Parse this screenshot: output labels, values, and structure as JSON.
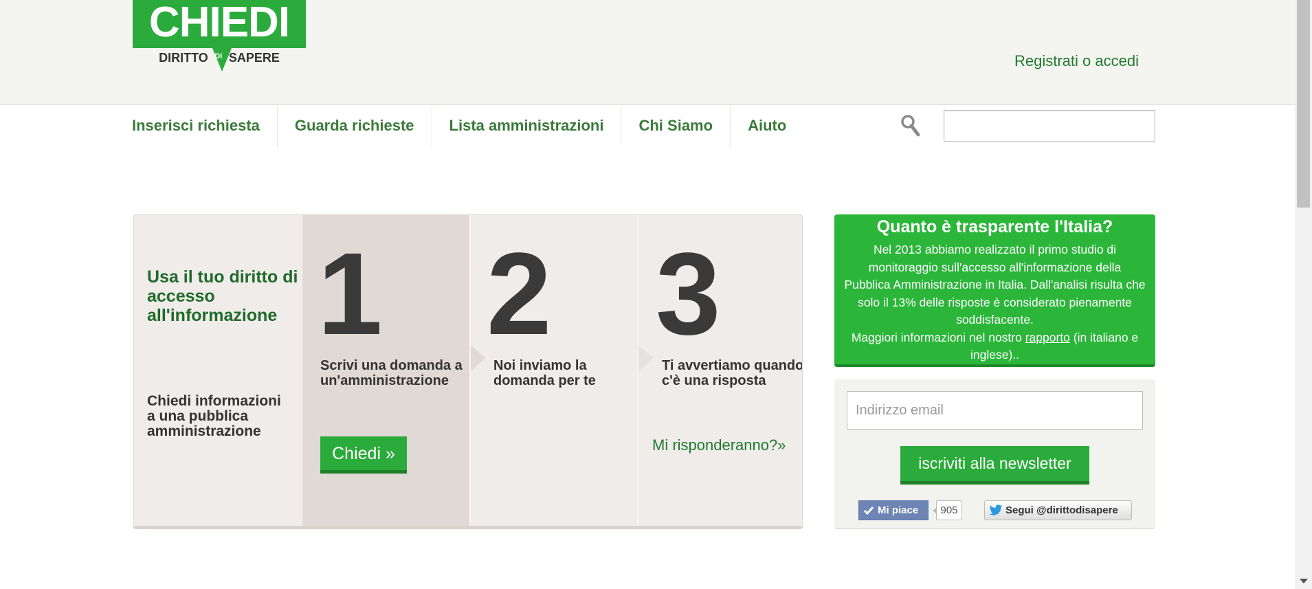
{
  "header": {
    "logo_main": "CHIEDI",
    "logo_sub_left": "DIRITTO",
    "logo_sub_mid": "DI",
    "logo_sub_right": "SAPERE",
    "register_label": "Registrati o accedi"
  },
  "nav": {
    "items": [
      {
        "label": "Inserisci richiesta"
      },
      {
        "label": "Guarda richieste"
      },
      {
        "label": "Lista amministrazioni"
      },
      {
        "label": "Chi Siamo"
      },
      {
        "label": "Aiuto"
      }
    ],
    "search_placeholder": ""
  },
  "steps": {
    "intro_title": "Usa il tuo diritto di accesso all'informazione",
    "intro_text": "Chiedi informazioni a una pubblica amministrazione",
    "step1": {
      "number": "1",
      "text": "Scrivi una domanda a un'amministrazione",
      "button": "Chiedi »"
    },
    "step2": {
      "number": "2",
      "text": "Noi inviamo la domanda per te"
    },
    "step3": {
      "number": "3",
      "text": "Ti avvertiamo quando c'è una risposta",
      "link": "Mi risponderanno?»"
    }
  },
  "transparency": {
    "title": "Quanto è trasparente l'Italia?",
    "text": "Nel 2013 abbiamo realizzato il primo studio di monitoraggio sull'accesso all'informazione della Pubblica Amministrazione in Italia. Dall'analisi risulta che solo il 13% delle risposte è considerato pienamente soddisfacente.",
    "more_prefix": "Maggiori informazioni nel nostro",
    "more_link": "rapporto",
    "more_suffix": "(in italiano e inglese).."
  },
  "newsletter": {
    "email_placeholder": "Indirizzo email",
    "button_label": "iscriviti alla newsletter",
    "fb_like_label": "Mi piace",
    "fb_like_count": "905",
    "twitter_label": "Segui @dirittodisapere"
  },
  "colors": {
    "brand_green": "#2bab3b",
    "nav_green": "#3a7a3a",
    "link_green": "#1f7a2e"
  }
}
